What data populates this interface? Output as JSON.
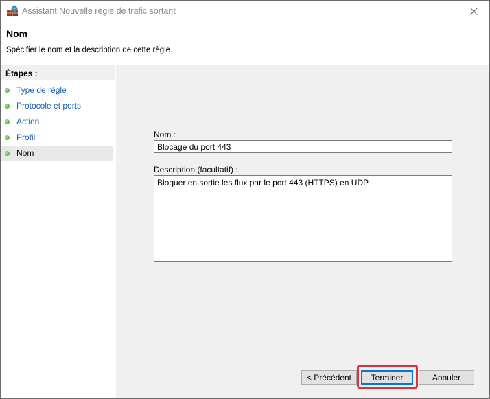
{
  "window": {
    "title": "Assistant Nouvelle règle de trafic sortant"
  },
  "header": {
    "title": "Nom",
    "description": "Spécifier le nom et la description de cette règle."
  },
  "steps": {
    "title": "Étapes :",
    "items": [
      {
        "label": "Type de règle"
      },
      {
        "label": "Protocole et ports"
      },
      {
        "label": "Action"
      },
      {
        "label": "Profil"
      },
      {
        "label": "Nom"
      }
    ],
    "current_index": 4
  },
  "form": {
    "name_label": "Nom :",
    "name_value": "Blocage du port 443",
    "description_label": "Description (facultatif) :",
    "description_value": "Bloquer en sortie les flux par le port 443 (HTTPS) en UDP"
  },
  "buttons": {
    "previous": "< Précédent",
    "finish": "Terminer",
    "cancel": "Annuler"
  },
  "colors": {
    "link": "#1a5fb4",
    "highlight": "#e0303e",
    "default_button_border": "#0078d7",
    "step_bullet": "#2fa41f"
  }
}
